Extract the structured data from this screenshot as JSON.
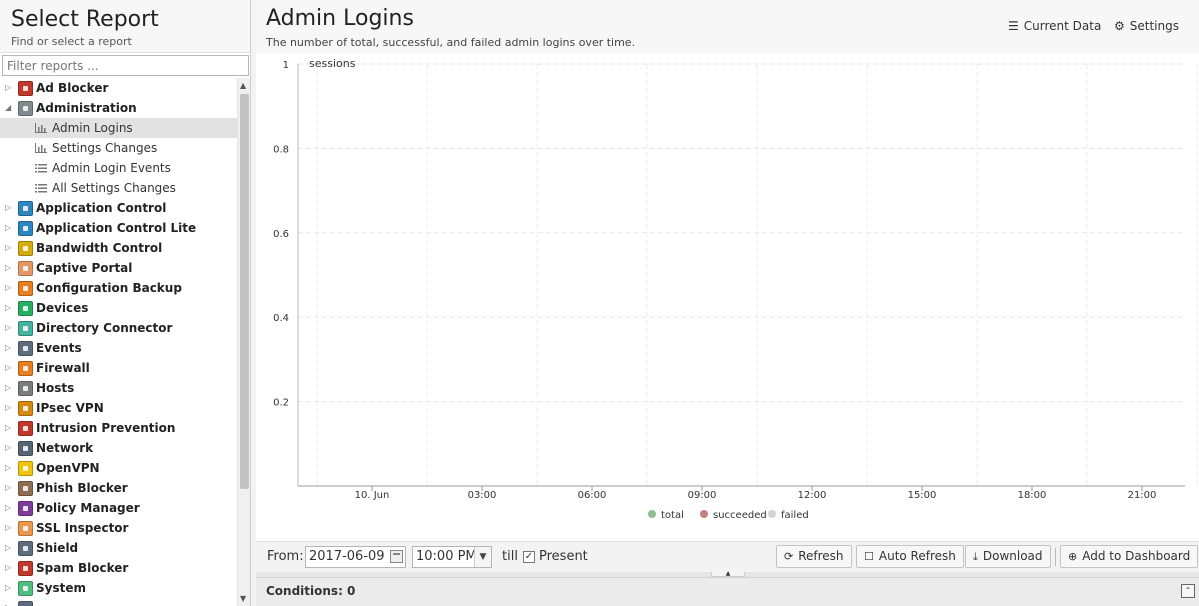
{
  "sidebar": {
    "title": "Select Report",
    "subtitle": "Find or select a report",
    "filter_placeholder": "Filter reports ...",
    "items": [
      {
        "label": "Ad Blocker",
        "color": "#c0392b"
      },
      {
        "label": "Administration",
        "color": "#7f8c8d",
        "expanded": true,
        "children": [
          {
            "label": "Admin Logins",
            "icon": "bar-chart-icon",
            "selected": true
          },
          {
            "label": "Settings Changes",
            "icon": "bar-chart-icon"
          },
          {
            "label": "Admin Login Events",
            "icon": "list-icon"
          },
          {
            "label": "All Settings Changes",
            "icon": "list-icon"
          }
        ]
      },
      {
        "label": "Application Control",
        "color": "#2e86c1"
      },
      {
        "label": "Application Control Lite",
        "color": "#2e86c1"
      },
      {
        "label": "Bandwidth Control",
        "color": "#d4ac0d"
      },
      {
        "label": "Captive Portal",
        "color": "#e59866"
      },
      {
        "label": "Configuration Backup",
        "color": "#e67e22"
      },
      {
        "label": "Devices",
        "color": "#27ae60"
      },
      {
        "label": "Directory Connector",
        "color": "#45b39d"
      },
      {
        "label": "Events",
        "color": "#5d6d7e"
      },
      {
        "label": "Firewall",
        "color": "#e67e22"
      },
      {
        "label": "Hosts",
        "color": "#7b7d7d"
      },
      {
        "label": "IPsec VPN",
        "color": "#d68910"
      },
      {
        "label": "Intrusion Prevention",
        "color": "#c0392b"
      },
      {
        "label": "Network",
        "color": "#566573"
      },
      {
        "label": "OpenVPN",
        "color": "#f1c40f"
      },
      {
        "label": "Phish Blocker",
        "color": "#8e6e53"
      },
      {
        "label": "Policy Manager",
        "color": "#7d3c98"
      },
      {
        "label": "SSL Inspector",
        "color": "#eb984e"
      },
      {
        "label": "Shield",
        "color": "#5d6d7e"
      },
      {
        "label": "Spam Blocker",
        "color": "#c0392b"
      },
      {
        "label": "System",
        "color": "#52be80"
      },
      {
        "label": "",
        "color": "#5d6d7e"
      }
    ]
  },
  "main": {
    "title": "Admin Logins",
    "subtitle": "The number of total, successful, and failed admin logins over time.",
    "current_data_label": "Current Data",
    "settings_label": "Settings"
  },
  "chart_data": {
    "type": "line",
    "title": "",
    "ylabel": "sessions",
    "ylim": [
      0,
      1
    ],
    "yticks": [
      "1",
      "0.8",
      "0.6",
      "0.4",
      "0.2"
    ],
    "xticks": [
      "10. Jun",
      "03:00",
      "06:00",
      "09:00",
      "12:00",
      "15:00",
      "18:00",
      "21:00"
    ],
    "grid": true,
    "legend_position": "bottom",
    "series": [
      {
        "name": "total",
        "color": "#8fbc8f",
        "values": []
      },
      {
        "name": "succeeded",
        "color": "#c48080",
        "values": []
      },
      {
        "name": "failed",
        "color": "#d3d3d3",
        "values": []
      }
    ]
  },
  "toolbar": {
    "from_label": "From:",
    "date_value": "2017-06-09",
    "time_value": "10:00 PM",
    "till_label": "till",
    "present_label": "Present",
    "present_checked": "✓",
    "refresh_label": "Refresh",
    "auto_refresh_label": "Auto Refresh",
    "download_label": "Download",
    "add_dashboard_label": "Add to Dashboard"
  },
  "conditions": {
    "label": "Conditions: 0"
  }
}
